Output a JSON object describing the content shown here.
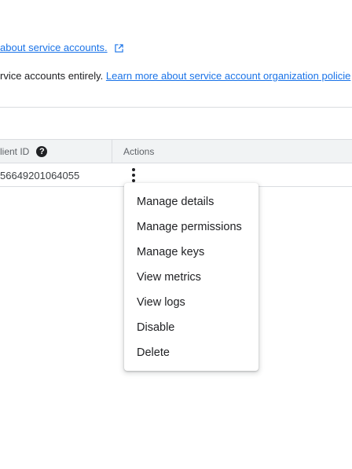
{
  "info": {
    "line1_link": "about service accounts.",
    "line2_text": "rvice accounts entirely. ",
    "line2_link": "Learn more about service account organization policie"
  },
  "table": {
    "headers": {
      "client_id": "lient ID",
      "help_glyph": "?",
      "actions": "Actions"
    },
    "rows": [
      {
        "client_id": "56649201064055"
      }
    ]
  },
  "menu": {
    "items": [
      "Manage details",
      "Manage permissions",
      "Manage keys",
      "View metrics",
      "View logs",
      "Disable",
      "Delete"
    ]
  },
  "icons": {
    "external_link": "external-link-icon",
    "help": "help-icon",
    "more_vert": "more-vert-icon"
  },
  "colors": {
    "link": "#1a73e8",
    "header_bg": "#f1f3f4",
    "divider": "#dadce0"
  }
}
